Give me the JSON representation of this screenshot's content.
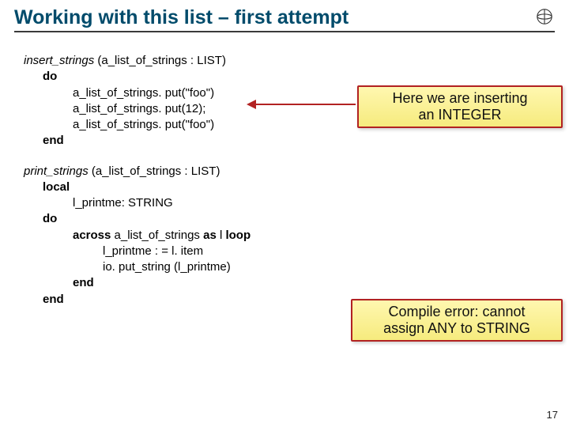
{
  "slide": {
    "title": "Working with this list – first attempt",
    "page_number": "17"
  },
  "code1": {
    "sig_name": "insert_strings ",
    "sig_params": "(a_list_of_strings : LIST)",
    "do": "do",
    "l1": "a_list_of_strings. put(\"foo\")",
    "l2": "a_list_of_strings. put(12);",
    "l3": "a_list_of_strings. put(\"foo\")",
    "end": "end"
  },
  "code2": {
    "sig_name": "print_strings ",
    "sig_params": "(a_list_of_strings : LIST)",
    "local": "local",
    "local_decl": "l_printme: STRING",
    "do": "do",
    "across_kw1": "across",
    "across_mid": " a_list_of_strings ",
    "across_kw2": "as",
    "across_tail": " l ",
    "across_kw3": "loop",
    "l1": "l_printme : = l. item",
    "l2": "io. put_string (l_printme)",
    "end_inner": "end",
    "end": "end"
  },
  "callouts": {
    "c1_line1": "Here we are inserting",
    "c1_line2": "an INTEGER",
    "c2_line1": "Compile error: cannot",
    "c2_line2": "assign ANY to STRING"
  }
}
